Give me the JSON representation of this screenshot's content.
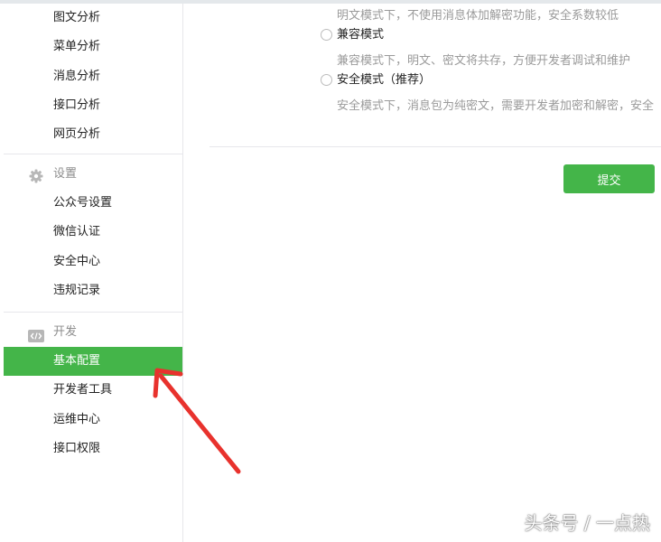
{
  "sidebar": {
    "analysis_items": [
      {
        "label": "图文分析"
      },
      {
        "label": "菜单分析"
      },
      {
        "label": "消息分析"
      },
      {
        "label": "接口分析"
      },
      {
        "label": "网页分析"
      }
    ],
    "settings": {
      "title": "设置",
      "icon": "gear-icon",
      "items": [
        {
          "label": "公众号设置"
        },
        {
          "label": "微信认证"
        },
        {
          "label": "安全中心"
        },
        {
          "label": "违规记录"
        }
      ]
    },
    "develop": {
      "title": "开发",
      "icon": "code-icon",
      "items": [
        {
          "label": "基本配置",
          "active": true
        },
        {
          "label": "开发者工具"
        },
        {
          "label": "运维中心"
        },
        {
          "label": "接口权限"
        }
      ]
    }
  },
  "main": {
    "plaintext_desc": "明文模式下，不使用消息体加解密功能，安全系数较低",
    "options": [
      {
        "label": "兼容模式",
        "desc": "兼容模式下，明文、密文将共存，方便开发者调试和维护"
      },
      {
        "label": "安全模式（推荐）",
        "desc": "安全模式下，消息包为纯密文，需要开发者加密和解密，安全"
      }
    ],
    "submit_label": "提交"
  },
  "watermark": "头条号 / 一点热",
  "colors": {
    "accent": "#44b549",
    "arrow": "#e8322d"
  }
}
